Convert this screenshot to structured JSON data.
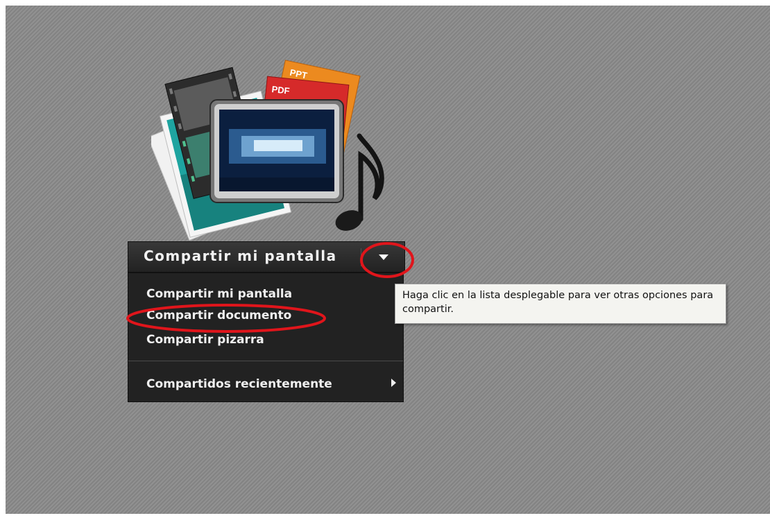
{
  "share_pod": {
    "main_button_label": "Compartir mi pantalla",
    "menu_items": [
      "Compartir mi pantalla",
      "Compartir documento",
      "Compartir pizarra",
      "Compartidos recientemente"
    ],
    "illustration_labels": {
      "ppt": "PPT",
      "pdf": "PDF"
    },
    "tooltip": "Haga clic en la lista desplegable para ver otras opciones para compartir."
  },
  "icons": [
    "share-content-illustration",
    "dropdown-arrow-icon",
    "submenu-arrow-icon"
  ],
  "colors": {
    "background": "#8a8a8a",
    "menu_bg": "#222222",
    "annotation": "#e0151b"
  }
}
